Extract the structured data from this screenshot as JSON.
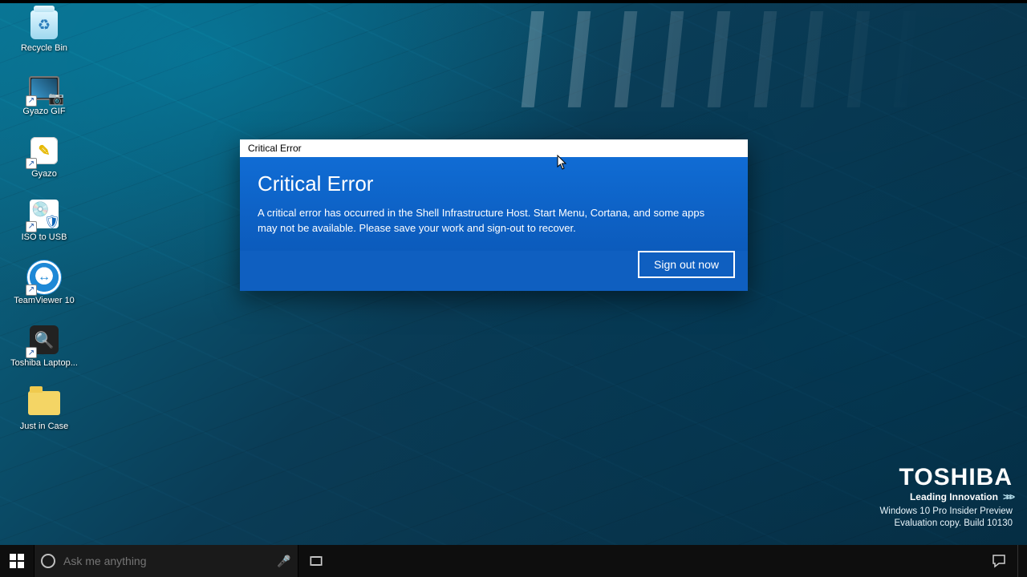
{
  "desktop_icons": [
    {
      "id": "recycle-bin",
      "label": "Recycle Bin"
    },
    {
      "id": "gyazo-gif",
      "label": "Gyazo GIF"
    },
    {
      "id": "gyazo",
      "label": "Gyazo"
    },
    {
      "id": "iso-to-usb",
      "label": "ISO to USB"
    },
    {
      "id": "teamviewer",
      "label": "TeamViewer 10"
    },
    {
      "id": "toshiba-laptop",
      "label": "Toshiba Laptop..."
    },
    {
      "id": "just-in-case",
      "label": "Just in Case"
    }
  ],
  "dialog": {
    "titlebar": "Critical Error",
    "heading": "Critical Error",
    "body": "A critical error has occurred in the Shell Infrastructure Host. Start Menu, Cortana, and some apps may not be available.  Please save your work and sign-out to recover.",
    "button": "Sign out now"
  },
  "branding": {
    "logo": "TOSHIBA",
    "tagline": "Leading Innovation",
    "chevrons": ">>>",
    "watermark_line1": "Windows 10 Pro Insider Preview",
    "watermark_line2": "Evaluation copy. Build 10130"
  },
  "taskbar": {
    "search_placeholder": "Ask me anything"
  }
}
